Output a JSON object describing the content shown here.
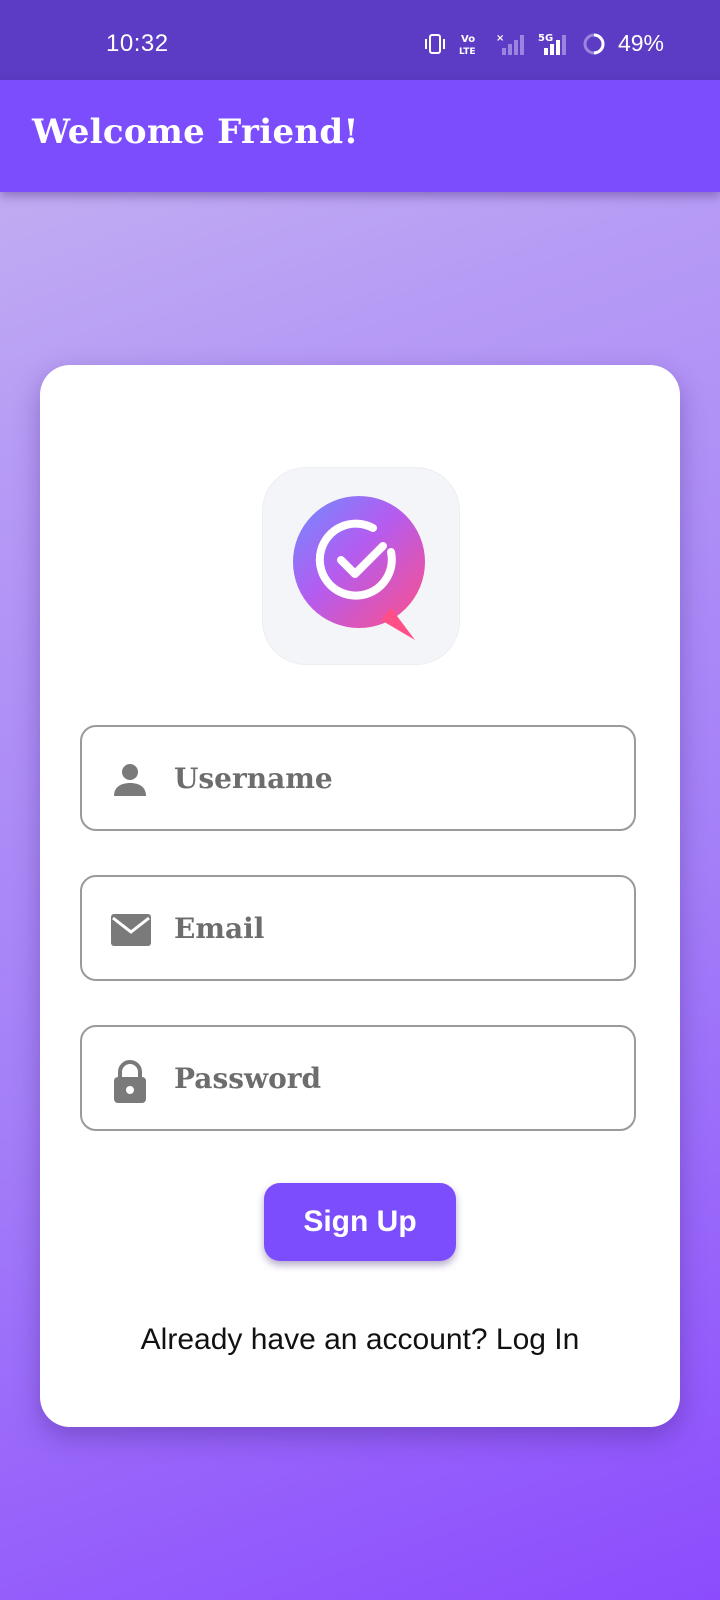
{
  "status_bar": {
    "time": "10:32",
    "battery": "49%",
    "icons": [
      "vibrate-icon",
      "volte-icon",
      "signal-no-service-icon",
      "signal-5g-icon",
      "battery-ring-icon"
    ],
    "volte_label": "Vo LTE",
    "network_label": "5G"
  },
  "app_bar": {
    "title": "Welcome Friend!"
  },
  "colors": {
    "status_bar": "#5c3cc4",
    "app_bar": "#7c4dfd",
    "accent": "#7c4dfd",
    "field_border": "#9a9a9a",
    "icon_gray": "#7a7a7a"
  },
  "form": {
    "logo_icon": "chat-check-logo-icon",
    "username": {
      "placeholder": "Username",
      "value": "",
      "icon": "person-icon"
    },
    "email": {
      "placeholder": "Email",
      "value": "",
      "icon": "mail-icon"
    },
    "password": {
      "placeholder": "Password",
      "value": "",
      "icon": "lock-icon"
    },
    "signup_label": "Sign Up",
    "login_prompt": "Already have an account? Log In"
  }
}
